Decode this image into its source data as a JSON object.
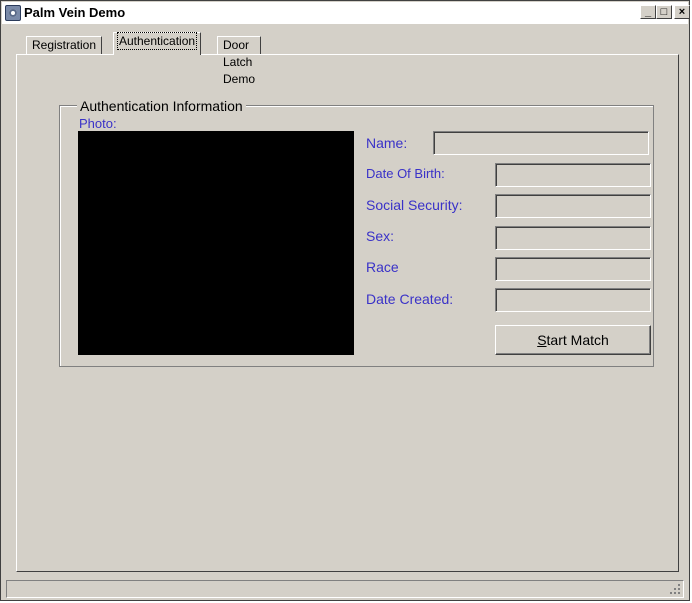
{
  "window": {
    "title": "Palm Vein Demo",
    "controls": {
      "minimize": "_",
      "maximize": "□",
      "close": "×"
    }
  },
  "tabs": [
    {
      "label": "Registration",
      "active": false
    },
    {
      "label": "Authentication",
      "active": true
    },
    {
      "label": "Door Latch Demo",
      "active": false
    }
  ],
  "auth_info": {
    "group_title": "Authentication Information",
    "photo_label": "Photo:",
    "fields": {
      "name": {
        "label": "Name:",
        "value": ""
      },
      "dob": {
        "label": "Date Of Birth:",
        "value": ""
      },
      "ssn": {
        "label": "Social Security:",
        "value": ""
      },
      "sex": {
        "label": "Sex:",
        "value": ""
      },
      "race": {
        "label": "Race",
        "value": ""
      },
      "date_created": {
        "label": "Date Created:",
        "value": ""
      }
    },
    "start_match": {
      "label_prefix": "S",
      "label_rest": "tart Match"
    }
  },
  "colors": {
    "label_text": "#3a32c8",
    "window_bg": "#d4d0c8",
    "photo_bg": "#000000"
  },
  "icons": {
    "app": "palm-vein-app-icon",
    "resize_grip": "resize-grip-icon"
  }
}
